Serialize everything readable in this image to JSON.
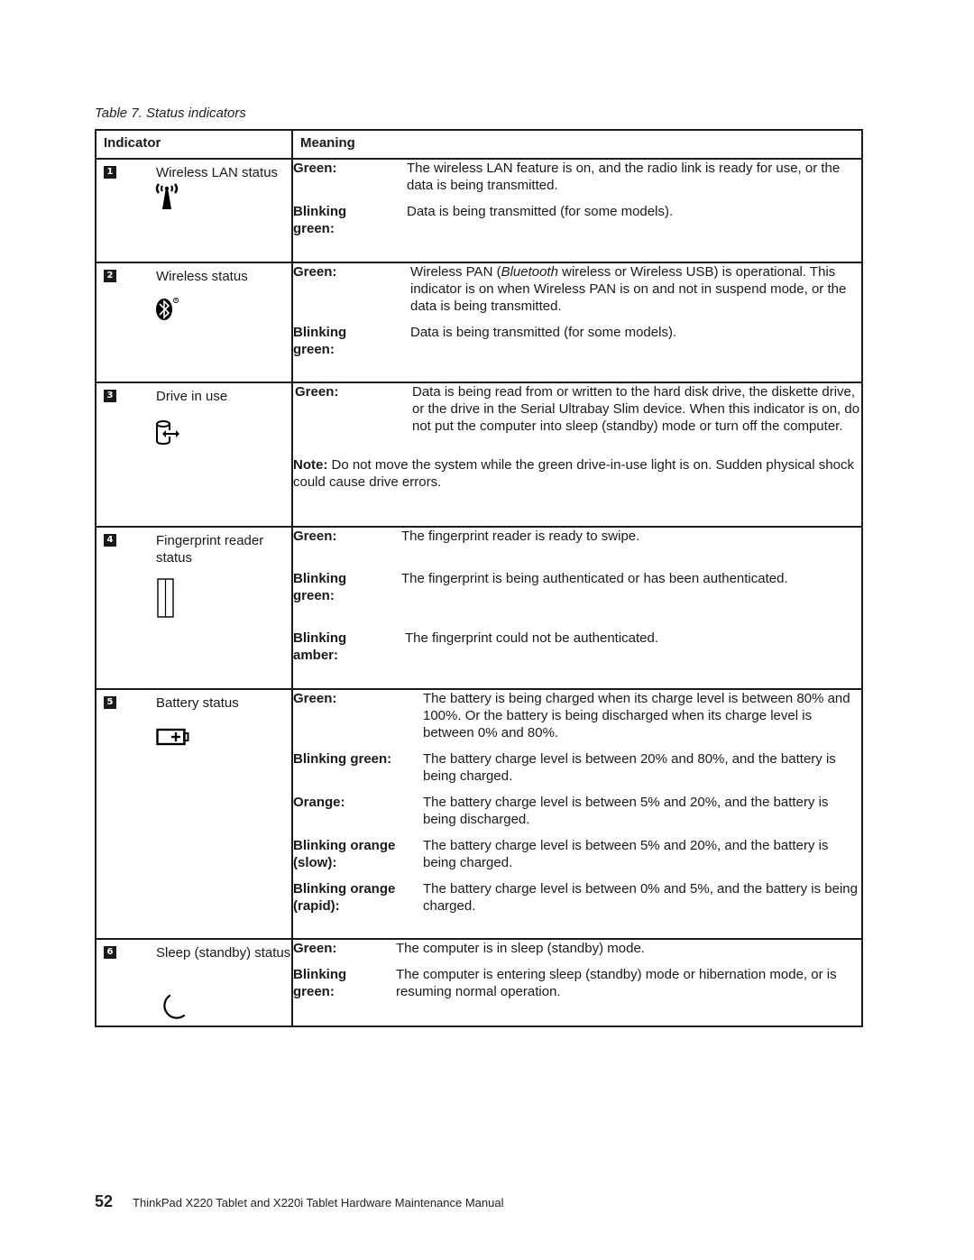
{
  "caption": "Table 7.  Status indicators",
  "headers": {
    "indicator": "Indicator",
    "meaning": "Meaning"
  },
  "rows": [
    {
      "number": "1",
      "name": "Wireless LAN status",
      "icon": "wireless-lan-icon",
      "states": [
        {
          "label": "Green:",
          "desc": "The wireless LAN feature is on, and the radio link is ready for use, or the data is being transmitted."
        },
        {
          "label": "Blinking green:",
          "desc": "Data is being transmitted (for some models)."
        }
      ]
    },
    {
      "number": "2",
      "name": "Wireless status",
      "icon": "bluetooth-icon",
      "states": [
        {
          "label": "Green:",
          "desc_pre": "Wireless PAN (",
          "desc_italic": "Bluetooth",
          "desc_post": " wireless or Wireless USB) is operational. This indicator is on when Wireless PAN is on and not in suspend mode, or the data is being transmitted."
        },
        {
          "label": "Blinking green:",
          "desc": "Data is being transmitted (for some models)."
        }
      ]
    },
    {
      "number": "3",
      "name": "Drive in use",
      "icon": "drive-in-use-icon",
      "states": [
        {
          "label": "Green:",
          "desc": "Data is being read from or written to the hard disk drive, the diskette drive, or the drive in the Serial Ultrabay Slim device. When this indicator is on, do not put the computer into sleep (standby) mode or turn off the computer."
        }
      ],
      "note_label": "Note:",
      "note_text": " Do not move the system while the green drive-in-use light is on. Sudden physical shock could cause drive errors."
    },
    {
      "number": "4",
      "name": "Fingerprint reader status",
      "icon": "fingerprint-reader-icon",
      "states": [
        {
          "label": "Green:",
          "desc": "The fingerprint reader is ready to swipe."
        },
        {
          "label": "Blinking green:",
          "desc": "The fingerprint is being authenticated or has been authenticated."
        },
        {
          "label": "Blinking amber:",
          "desc": "The fingerprint could not be authenticated."
        }
      ]
    },
    {
      "number": "5",
      "name": "Battery status",
      "icon": "battery-icon",
      "states": [
        {
          "label": "Green:",
          "desc": "The battery is being charged when its charge level is between 80% and 100%. Or the battery is being discharged when its charge level is between 0% and 80%."
        },
        {
          "label": "Blinking green:",
          "desc": "The battery charge level is between 20% and 80%, and the battery is being charged."
        },
        {
          "label": "Orange:",
          "desc": "The battery charge level is between 5% and 20%, and the battery is being discharged."
        },
        {
          "label": "Blinking orange (slow):",
          "desc": "The battery charge level is between 5% and 20%, and the battery is being charged."
        },
        {
          "label": "Blinking orange (rapid):",
          "desc": "The battery charge level is between 0% and 5%, and the battery is being charged."
        }
      ]
    },
    {
      "number": "6",
      "name": "Sleep (standby) status",
      "icon": "sleep-moon-icon",
      "states": [
        {
          "label": "Green:",
          "desc": "The computer is in sleep (standby) mode."
        },
        {
          "label": "Blinking green:",
          "desc": "The computer is entering sleep (standby) mode or hibernation mode, or is resuming normal operation."
        }
      ]
    }
  ],
  "footer": {
    "page_number": "52",
    "title": "ThinkPad X220 Tablet and X220i Tablet Hardware Maintenance Manual"
  }
}
